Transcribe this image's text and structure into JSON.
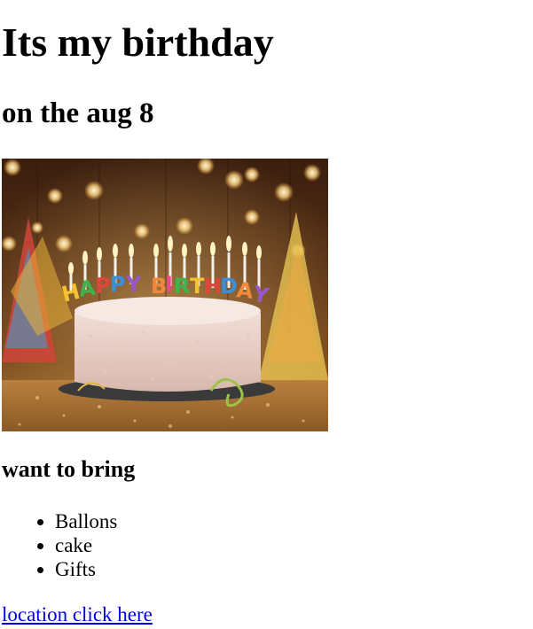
{
  "header": {
    "title": "Its my birthday",
    "subtitle": "on the aug 8"
  },
  "image": {
    "subject": "birthday-cake-with-candles",
    "candle_text": "HAPPY BIRTHDAY"
  },
  "bring": {
    "heading": "want to bring",
    "items": [
      "Ballons",
      "cake",
      "Gifts"
    ]
  },
  "location": {
    "link_text": "location click here"
  },
  "colors": {
    "link": "#0000ee",
    "text": "#000000",
    "background": "#ffffff"
  }
}
